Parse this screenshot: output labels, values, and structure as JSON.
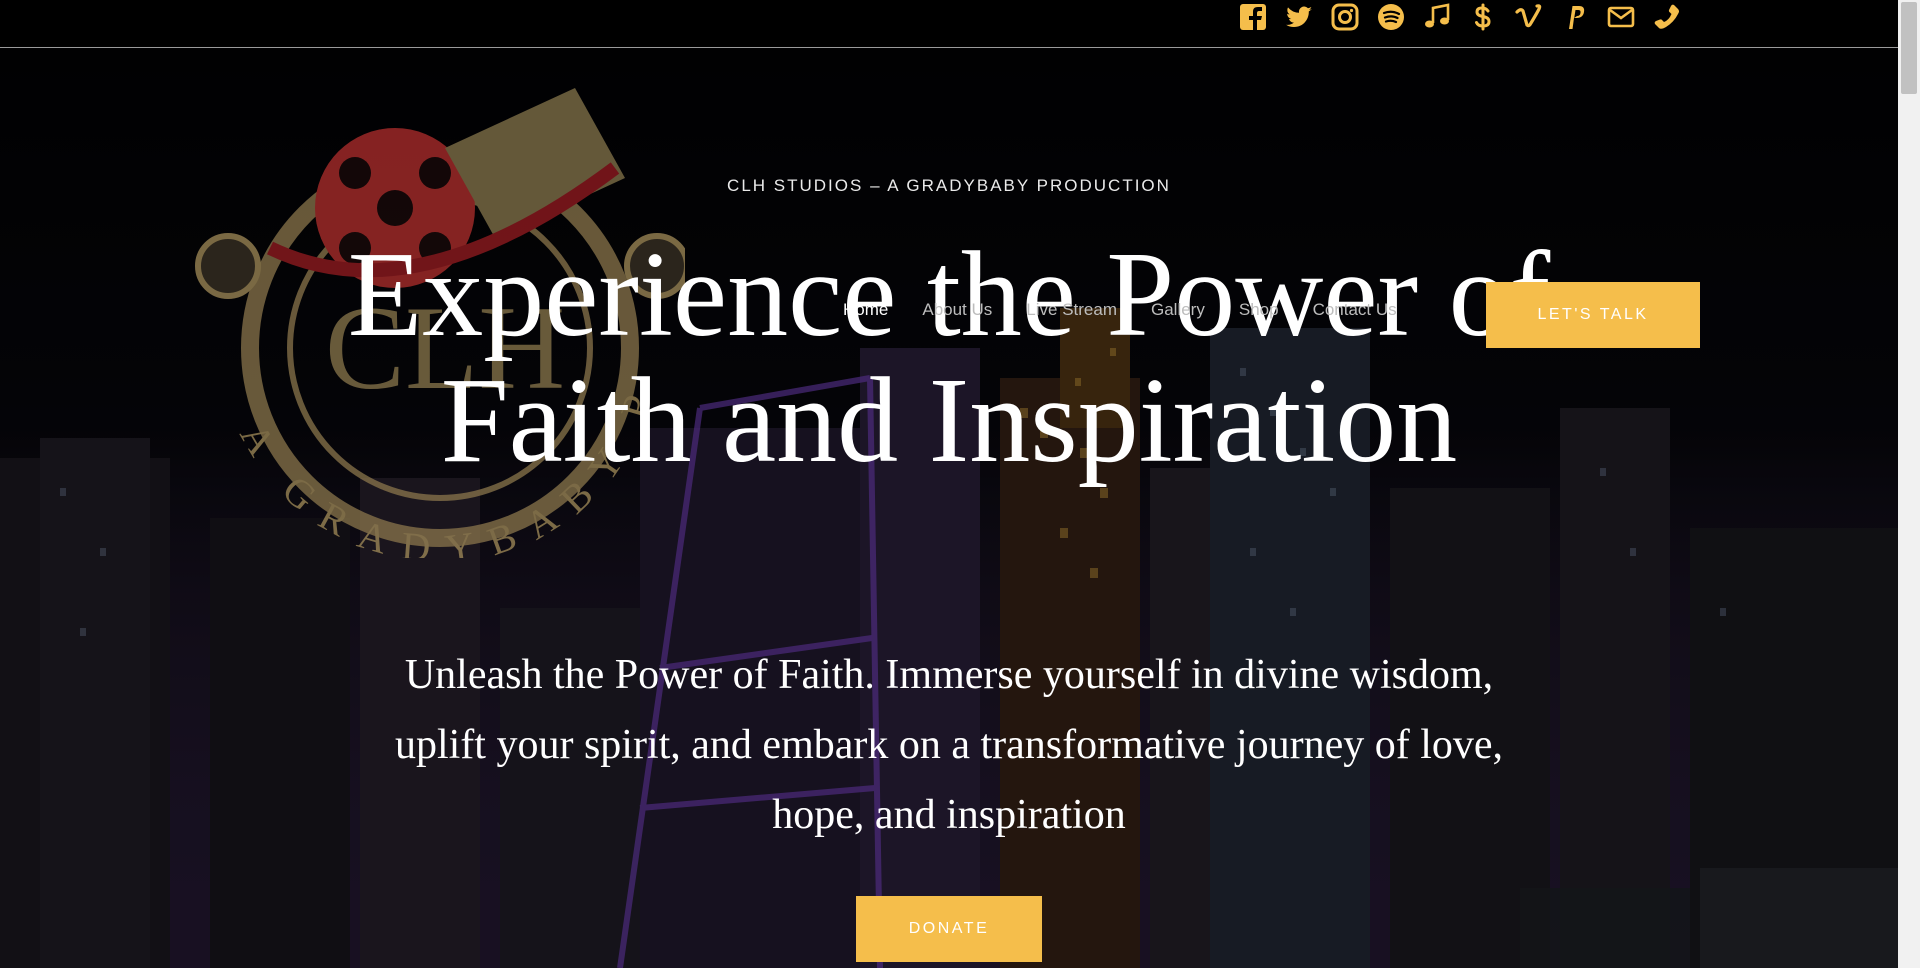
{
  "topbar": {
    "social_icons": [
      {
        "name": "facebook-icon"
      },
      {
        "name": "twitter-icon"
      },
      {
        "name": "instagram-icon"
      },
      {
        "name": "spotify-icon"
      },
      {
        "name": "music-icon"
      },
      {
        "name": "dollar-icon"
      },
      {
        "name": "vimeo-icon"
      },
      {
        "name": "paypal-icon"
      },
      {
        "name": "email-icon"
      },
      {
        "name": "phone-icon"
      }
    ],
    "icon_color": "#f5be4b"
  },
  "logo": {
    "text": "CLH STUDIOS",
    "tagline": "A GRADYBABY PRODUCTION"
  },
  "nav": {
    "items": [
      "Home",
      "About Us",
      "Live Stream",
      "Gallery",
      "Shop",
      "Contact Us"
    ],
    "active": "Home",
    "cta_label": "LET'S TALK"
  },
  "hero": {
    "eyebrow": "CLH STUDIOS – A GRADYBABY PRODUCTION",
    "headline": "Experience the Power of Faith and Inspiration",
    "subheading": "Unleash the Power of Faith. Immerse yourself in divine wisdom, uplift your spirit, and embark on a transformative journey of love, hope, and inspiration",
    "donate_label": "DONATE"
  },
  "colors": {
    "accent": "#f5be4b",
    "background": "#000000",
    "text": "#ffffff"
  }
}
